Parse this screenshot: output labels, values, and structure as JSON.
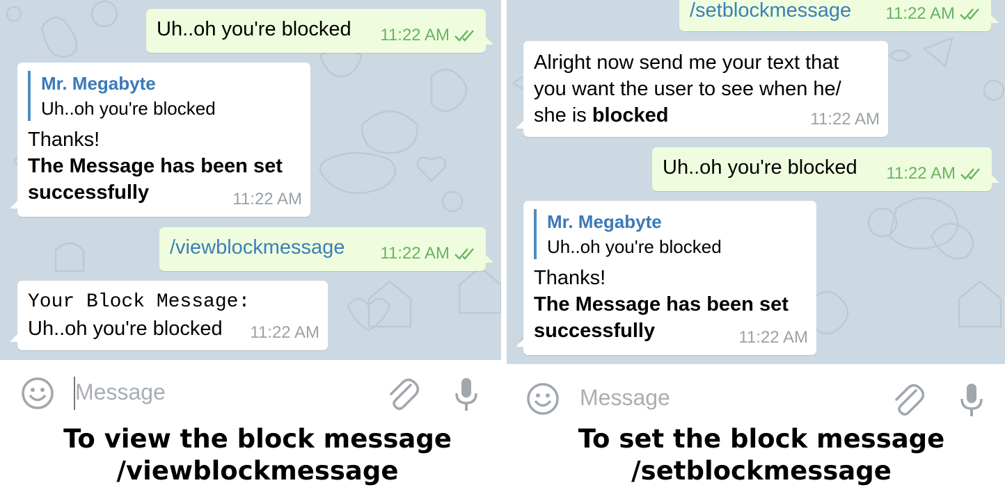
{
  "left": {
    "messages": {
      "m1_text": "Uh..oh you're blocked",
      "m1_time": "11:22 AM",
      "m2_reply_name": "Mr. Megabyte",
      "m2_reply_text": "Uh..oh you're blocked",
      "m2_line1": "Thanks!",
      "m2_line2": "The Message has been set",
      "m2_line3": "successfully",
      "m2_time": "11:22 AM",
      "m3_text": "/viewblockmessage",
      "m3_time": "11:22 AM",
      "m4_line1": "Your Block Message:",
      "m4_line2": "Uh..oh you're blocked",
      "m4_time": "11:22 AM"
    },
    "input_placeholder": "Message",
    "caption_line1": "To view the block message",
    "caption_line2": "/viewblockmessage"
  },
  "right": {
    "messages": {
      "m1_text": "/setblockmessage",
      "m1_time": "11:22 AM",
      "m2_line1": "Alright now send me your text that",
      "m2_line2": "you want the user to see when he/",
      "m2_line3a": "she is ",
      "m2_line3b": "blocked",
      "m2_time": "11:22 AM",
      "m3_text": "Uh..oh you're blocked",
      "m3_time": "11:22 AM",
      "m4_reply_name": "Mr. Megabyte",
      "m4_reply_text": "Uh..oh you're blocked",
      "m4_line1": "Thanks!",
      "m4_line2": "The Message has been set",
      "m4_line3": "successfully",
      "m4_time": "11:22 AM"
    },
    "input_placeholder": "Message",
    "caption_line1": "To set the block message",
    "caption_line2": "/setblockmessage"
  },
  "colors": {
    "chat_background": "#cdd9e2",
    "incoming_bubble": "#ffffff",
    "outgoing_bubble": "#effdde",
    "outgoing_time": "#67b35f",
    "reply_accent": "#4d8dc0",
    "command_link": "#3b7fb8"
  },
  "icons": [
    "emoji-icon",
    "attach-icon",
    "mic-icon",
    "double-check-icon"
  ]
}
